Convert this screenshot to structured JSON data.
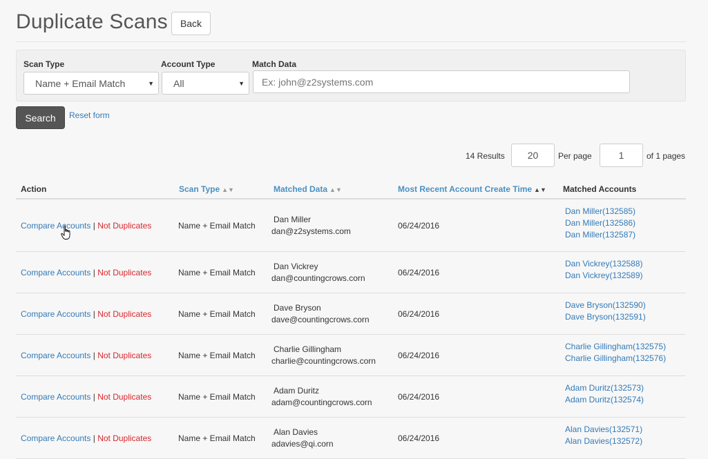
{
  "header": {
    "title": "Duplicate Scans",
    "back_label": "Back"
  },
  "filters": {
    "scan_type_label": "Scan Type",
    "scan_type_value": "Name + Email Match",
    "account_type_label": "Account Type",
    "account_type_value": "All",
    "match_data_label": "Match Data",
    "match_data_placeholder": "Ex: john@z2systems.com",
    "search_label": "Search",
    "reset_label": "Reset form"
  },
  "pagination": {
    "results": "14 Results",
    "per_page_value": "20",
    "per_page_label": "Per page",
    "page_value": "1",
    "of_pages": "of 1 pages"
  },
  "table": {
    "columns": [
      "Action",
      "Scan Type",
      "Matched Data",
      "Most Recent Account Create Time",
      "Matched Accounts"
    ],
    "compare_label": "Compare Accounts",
    "separator": "|",
    "not_dup_label": "Not Duplicates",
    "rows": [
      {
        "scan_type": "Name + Email Match",
        "name": "Dan Miller",
        "email": "dan@z2systems.com",
        "date": "06/24/2016",
        "accounts": [
          "Dan Miller(132585)",
          "Dan Miller(132586)",
          "Dan Miller(132587)"
        ]
      },
      {
        "scan_type": "Name + Email Match",
        "name": "Dan Vickrey",
        "email": "dan@countingcrows.corn",
        "date": "06/24/2016",
        "accounts": [
          "Dan Vickrey(132588)",
          "Dan Vickrey(132589)"
        ]
      },
      {
        "scan_type": "Name + Email Match",
        "name": "Dave Bryson",
        "email": "dave@countingcrows.corn",
        "date": "06/24/2016",
        "accounts": [
          "Dave Bryson(132590)",
          "Dave Bryson(132591)"
        ]
      },
      {
        "scan_type": "Name + Email Match",
        "name": "Charlie Gillingham",
        "email": "charlie@countingcrows.corn",
        "date": "06/24/2016",
        "accounts": [
          "Charlie Gillingham(132575)",
          "Charlie Gillingham(132576)"
        ]
      },
      {
        "scan_type": "Name + Email Match",
        "name": "Adam Duritz",
        "email": "adam@countingcrows.corn",
        "date": "06/24/2016",
        "accounts": [
          "Adam Duritz(132573)",
          "Adam Duritz(132574)"
        ]
      },
      {
        "scan_type": "Name + Email Match",
        "name": "Alan Davies",
        "email": "adavies@qi.corn",
        "date": "06/24/2016",
        "accounts": [
          "Alan Davies(132571)",
          "Alan Davies(132572)"
        ]
      }
    ]
  },
  "icons": {
    "cursor": "hand-pointer-icon",
    "sort": "sort-icon",
    "caret": "caret-down-icon"
  }
}
